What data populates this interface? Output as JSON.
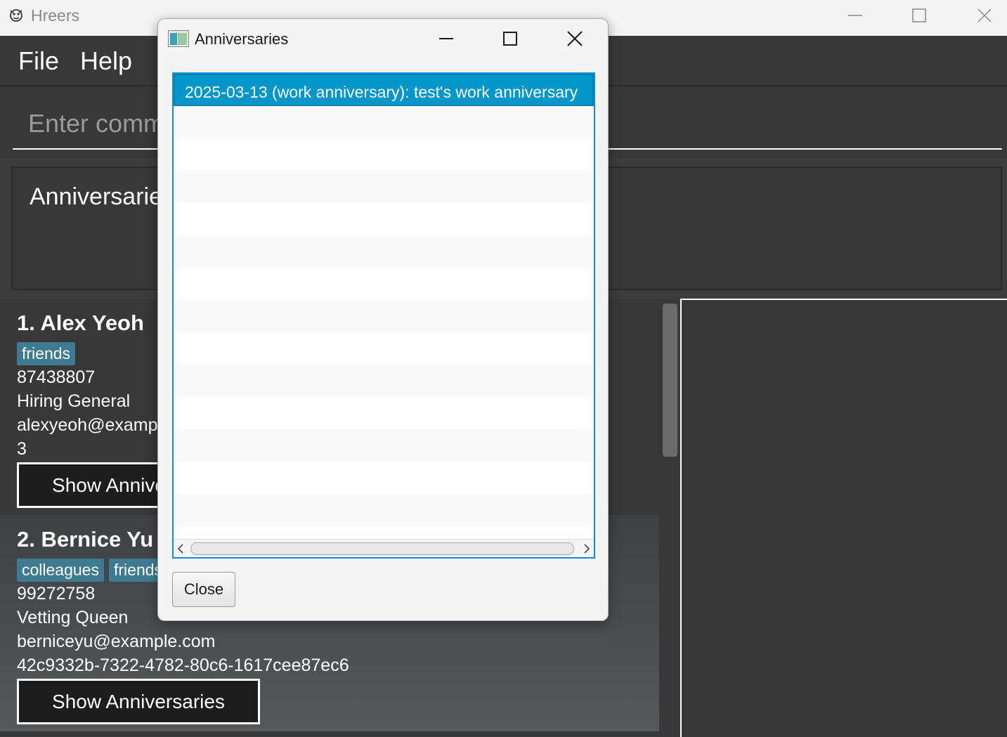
{
  "window": {
    "title": "Hreers",
    "icon": "app-mascot-icon"
  },
  "menubar": {
    "items": [
      "File",
      "Help"
    ]
  },
  "command": {
    "placeholder": "Enter command here..."
  },
  "result": {
    "text": "Anniversaries"
  },
  "persons": [
    {
      "index_name": "1. Alex Yeoh",
      "tags": [
        "friends"
      ],
      "phone": "87438807",
      "job": "Hiring General",
      "email": "alexyeoh@example.com",
      "id": "3",
      "button_label": "Show Anniversaries"
    },
    {
      "index_name": "2. Bernice Yu",
      "tags": [
        "colleagues",
        "friends"
      ],
      "phone": "99272758",
      "job": "Vetting Queen",
      "email": "berniceyu@example.com",
      "id": "42c9332b-7322-4782-80c6-1617cee87ec6",
      "button_label": "Show Anniversaries"
    }
  ],
  "dialog": {
    "title": "Anniversaries",
    "icon": "java-window-icon",
    "anniversaries": [
      "2025-03-13 (work anniversary): test's work anniversary"
    ],
    "close_label": "Close"
  },
  "colors": {
    "accent": "#0096c9",
    "tag_bg": "#3e7b91",
    "app_bg": "#383838"
  }
}
